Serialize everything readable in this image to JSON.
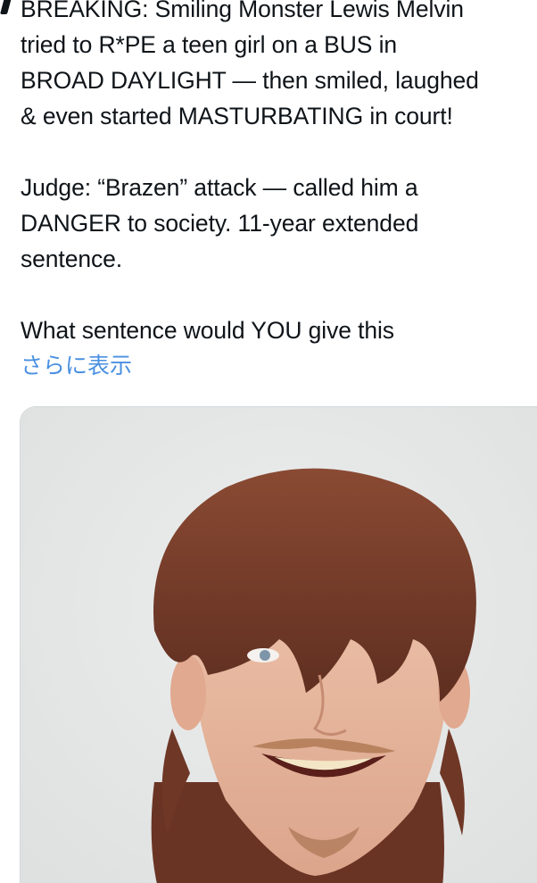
{
  "tweet": {
    "paragraphs": [
      "BREAKING: Smiling Monster Lewis Melvin\ntried to R*PE a teen girl on a BUS in\nBROAD DAYLIGHT — then smiled, laughed\n& even started MASTURBATING in court!",
      "Judge: “Brazen” attack — called him a\nDANGER to society. 11-year extended\nsentence.",
      "What sentence would YOU give this"
    ],
    "show_more_label": "さらに表示"
  },
  "media": {
    "kind": "mugshot-photo",
    "background_color": "#e6e8e8",
    "hair_color": "#7a3f2c",
    "skin_color": "#e9b9a0"
  },
  "colors": {
    "text": "#0f1419",
    "link": "#4a90e2",
    "card_border": "#d5d9dc"
  }
}
